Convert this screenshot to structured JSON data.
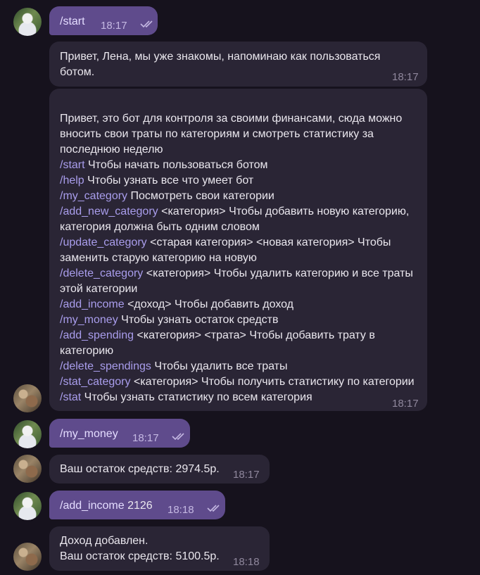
{
  "messages": [
    {
      "kind": "out",
      "text": "/start",
      "time": "18:17"
    },
    {
      "kind": "in",
      "text": "Привет, Лена, мы уже знакомы, напоминаю как пользоваться ботом.",
      "time": "18:17"
    },
    {
      "kind": "in",
      "time": "18:17",
      "intro": "Привет, это бот для контроля за своими финансами, сюда можно вносить свои траты по категориям и смотреть статистику за последнюю неделю",
      "commands": [
        {
          "cmd": "/start",
          "desc": " Чтобы начать пользоваться ботом"
        },
        {
          "cmd": "/help",
          "desc": " Чтобы узнать все что умеет бот"
        },
        {
          "cmd": "/my_category",
          "desc": " Посмотреть свои категории"
        },
        {
          "cmd": "/add_new_category",
          "desc": " <категория> Чтобы добавить новую категорию, категория должна быть одним словом"
        },
        {
          "cmd": "/update_category",
          "desc": " <старая категория> <новая категория> Чтобы заменить старую категорию на новую"
        },
        {
          "cmd": "/delete_category",
          "desc": " <категория> Чтобы удалить категорию и все траты этой категории"
        },
        {
          "cmd": "/add_income",
          "desc": " <доход> Чтобы добавить доход"
        },
        {
          "cmd": "/my_money",
          "desc": " Чтобы узнать остаток средств"
        },
        {
          "cmd": "/add_spending",
          "desc": " <категория> <трата> Чтобы добавить трату в категорию"
        },
        {
          "cmd": "/delete_spendings",
          "desc": " Чтобы удалить все траты"
        },
        {
          "cmd": "/stat_category",
          "desc": " <категория> Чтобы получить статистику по категории"
        },
        {
          "cmd": "/stat",
          "desc": " Чтобы узнать статистику по всем категория"
        }
      ]
    },
    {
      "kind": "out",
      "text": "/my_money",
      "time": "18:17"
    },
    {
      "kind": "in",
      "text": "Ваш остаток средств: 2974.5р.",
      "time": "18:17"
    },
    {
      "kind": "out",
      "text": "/add_income",
      "text_plain": " 2126",
      "time": "18:18"
    },
    {
      "kind": "in",
      "line1": "Доход добавлен.",
      "line2": "Ваш остаток средств: 5100.5р.",
      "time": "18:18"
    }
  ],
  "colors": {
    "background": "#16121d",
    "outgoing": "#5f4b8c",
    "incoming": "#2a2535",
    "command": "#a99dec"
  }
}
